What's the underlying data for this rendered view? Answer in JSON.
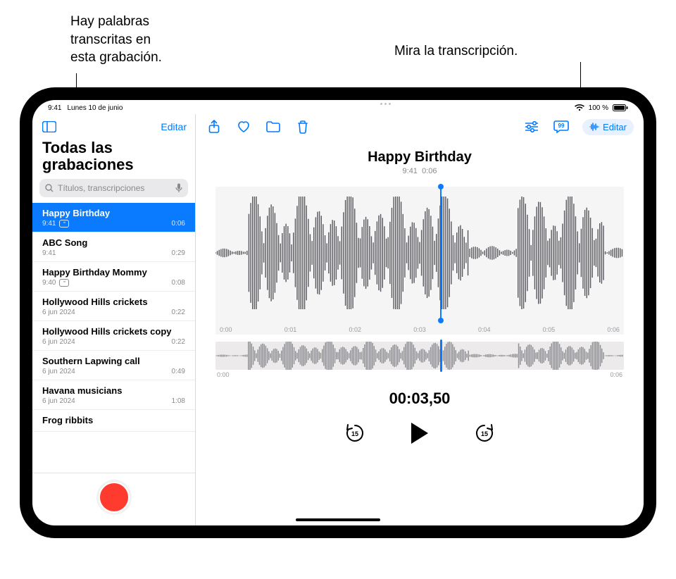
{
  "callouts": {
    "left": "Hay palabras\ntranscritas en\nesta grabación.",
    "right": "Mira la transcripción."
  },
  "statusbar": {
    "time": "9:41",
    "date": "Lunes 10 de junio",
    "wifi_icon": "wifi",
    "battery_pct": "100 %"
  },
  "sidebar": {
    "edit_label": "Editar",
    "title": "Todas las grabaciones",
    "search_placeholder": "Títulos, transcripciones",
    "items": [
      {
        "title": "Happy Birthday",
        "time": "9:41",
        "dur": "0:06",
        "transcript": true,
        "selected": true
      },
      {
        "title": "ABC Song",
        "time": "9:41",
        "dur": "0:29",
        "transcript": false
      },
      {
        "title": "Happy Birthday Mommy",
        "time": "9:40",
        "dur": "0:08",
        "transcript": true
      },
      {
        "title": "Hollywood Hills crickets",
        "time": "6 jun 2024",
        "dur": "0:22",
        "transcript": false
      },
      {
        "title": "Hollywood Hills crickets copy",
        "time": "6 jun 2024",
        "dur": "0:22",
        "transcript": false
      },
      {
        "title": "Southern Lapwing call",
        "time": "6 jun 2024",
        "dur": "0:49",
        "transcript": false
      },
      {
        "title": "Havana musicians",
        "time": "6 jun 2024",
        "dur": "1:08",
        "transcript": false
      },
      {
        "title": "Frog ribbits",
        "time": "",
        "dur": "",
        "transcript": false
      }
    ]
  },
  "main": {
    "title": "Happy Birthday",
    "subtitle_time": "9:41",
    "subtitle_dur": "0:06",
    "edit_label": "Editar",
    "ticks": [
      "0:00",
      "0:01",
      "0:02",
      "0:03",
      "0:04",
      "0:05",
      "0:06"
    ],
    "overview_start": "0:00",
    "overview_end": "0:06",
    "timecode": "00:03,50",
    "playhead_pct": 55
  },
  "icons": {
    "sidebar": "sidebar-icon",
    "share": "share-icon",
    "heart": "heart-icon",
    "folder": "folder-icon",
    "trash": "trash-icon",
    "sliders": "sliders-icon",
    "transcript": "transcript-icon",
    "waveform_edit": "waveform-edit-icon",
    "search": "search-icon",
    "mic": "mic-icon",
    "skip_back": "skip-back-15-icon",
    "play": "play-icon",
    "skip_fwd": "skip-forward-15-icon"
  },
  "colors": {
    "accent": "#007aff",
    "record": "#ff3b30"
  }
}
